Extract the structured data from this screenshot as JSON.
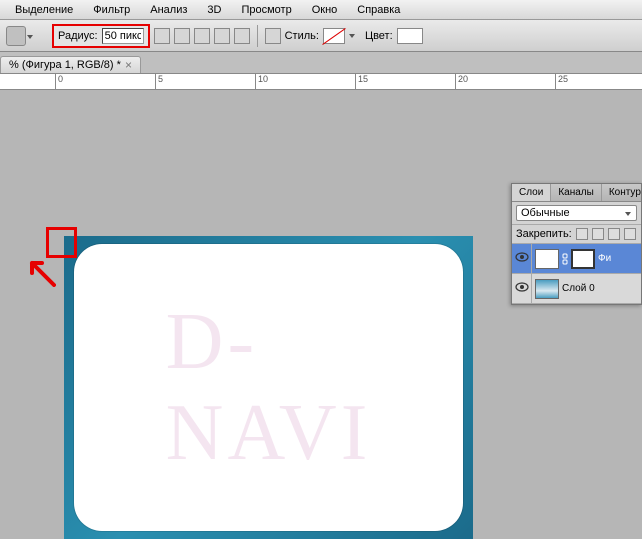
{
  "menubar": {
    "items": [
      "Выделение",
      "Фильтр",
      "Анализ",
      "3D",
      "Просмотр",
      "Окно",
      "Справка"
    ]
  },
  "options": {
    "radius_label": "Радиус:",
    "radius_value": "50 пикс",
    "style_label": "Стиль:",
    "color_label": "Цвет:"
  },
  "tab": {
    "title": "% (Фигура 1, RGB/8) *"
  },
  "ruler": {
    "marks": [
      "0",
      "5",
      "10",
      "15",
      "20",
      "25"
    ]
  },
  "canvas": {
    "watermark": "D-NAVI"
  },
  "layers_panel": {
    "tabs": [
      "Слои",
      "Каналы",
      "Контур"
    ],
    "blend_mode": "Обычные",
    "lock_label": "Закрепить:",
    "layers": [
      {
        "name": "Фи",
        "active": true,
        "has_mask": true
      },
      {
        "name": "Слой 0",
        "active": false,
        "has_mask": false
      }
    ]
  }
}
